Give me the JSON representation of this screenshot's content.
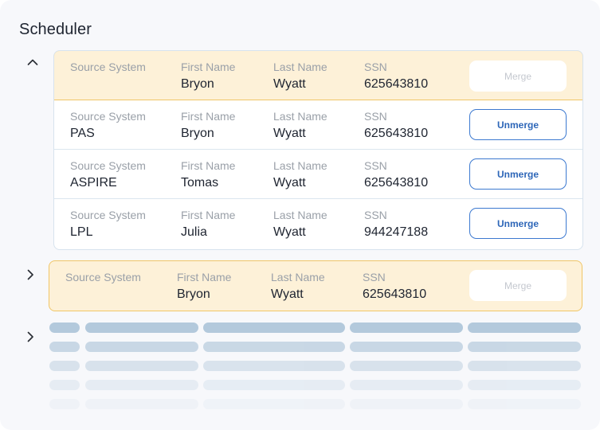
{
  "title": "Scheduler",
  "labels": {
    "source_system": "Source System",
    "first_name": "First Name",
    "last_name": "Last Name",
    "ssn": "SSN"
  },
  "buttons": {
    "merge": "Merge",
    "unmerge": "Unmerge"
  },
  "group1": {
    "expanded": true,
    "master": {
      "source_system": "",
      "first_name": "Bryon",
      "last_name": "Wyatt",
      "ssn": "625643810"
    },
    "records": [
      {
        "source_system": "PAS",
        "first_name": "Bryon",
        "last_name": "Wyatt",
        "ssn": "625643810"
      },
      {
        "source_system": "ASPIRE",
        "first_name": "Tomas",
        "last_name": "Wyatt",
        "ssn": "625643810"
      },
      {
        "source_system": "LPL",
        "first_name": "Julia",
        "last_name": "Wyatt",
        "ssn": "944247188"
      }
    ]
  },
  "group2": {
    "expanded": false,
    "master": {
      "source_system": "",
      "first_name": "Bryon",
      "last_name": "Wyatt",
      "ssn": "625643810"
    }
  },
  "colors": {
    "master_bg": "#fdf1d8",
    "master_border": "#f0c667",
    "unmerge_text": "#2d66b8",
    "skeleton": "#b3c9dc"
  },
  "icons": {
    "group1_toggle": "chevron-up-icon",
    "group2_toggle": "chevron-right-icon",
    "group3_toggle": "chevron-right-icon"
  }
}
